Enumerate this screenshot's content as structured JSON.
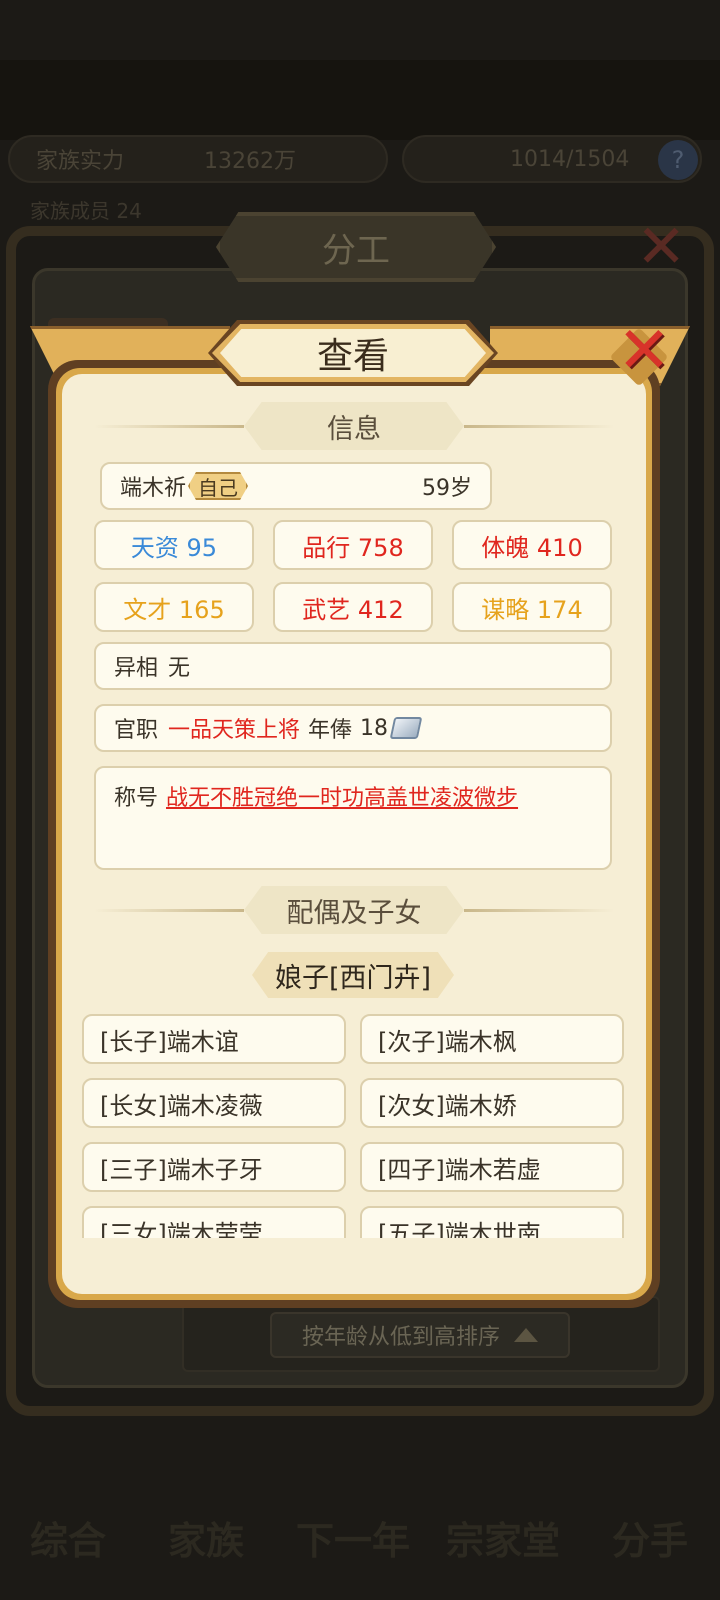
{
  "background": {
    "stats_row": [
      "家族实力",
      "13262万",
      "1014/1504"
    ],
    "stats_row2": "家族成员 24",
    "panel_title": "分工",
    "sort_button": "按年龄从低到高排序",
    "nav": [
      "综合",
      "家族",
      "下一年",
      "宗家堂",
      "分手"
    ]
  },
  "modal": {
    "title": "查看",
    "info_section": "信息",
    "name": "端木祈",
    "self_tag": "自己",
    "age": "59岁",
    "stats": [
      {
        "label": "天资 95",
        "color": "#3a8ad8"
      },
      {
        "label": "品行 758",
        "color": "#e0261e"
      },
      {
        "label": "体魄 410",
        "color": "#e0261e"
      },
      {
        "label": "文才 165",
        "color": "#e6a21c"
      },
      {
        "label": "武艺 412",
        "color": "#e0261e"
      },
      {
        "label": "谋略 174",
        "color": "#e6a21c"
      }
    ],
    "trait_label": "异相",
    "trait_value": "无",
    "office_label": "官职",
    "office_value": "一品天策上将",
    "salary_label": "年俸",
    "salary_value": "18",
    "salary_icon": "silver-ingot-icon",
    "honor_label": "称号",
    "honor_value": "战无不胜冠绝一时功高盖世凌波微步",
    "family_section": "配偶及子女",
    "spouse": "娘子[西门卉]",
    "children": [
      "[长子]端木谊",
      "[次子]端木枫",
      "[长女]端木凌薇",
      "[次女]端木娇",
      "[三子]端木子牙",
      "[四子]端木若虚",
      "[三女]端木莹莹",
      "[五子]端木世南"
    ]
  },
  "colors": {
    "accent_gold": "#d9a84a",
    "panel_bg": "#f6eed5",
    "red": "#e0261e",
    "blue": "#3a8ad8",
    "orange": "#e6a21c"
  }
}
